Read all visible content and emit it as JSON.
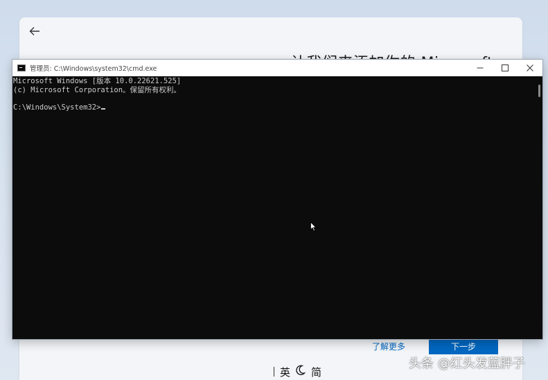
{
  "oobe": {
    "title": "让我们来添加你的 Microsoft",
    "learn_more": "了解更多",
    "next": "下一步"
  },
  "cmd": {
    "title": "管理员: C:\\Windows\\system32\\cmd.exe",
    "lines": [
      "Microsoft Windows [版本 10.0.22621.525]",
      "(c) Microsoft Corporation。保留所有权利。",
      "",
      "C:\\Windows\\System32>"
    ]
  },
  "ime": {
    "lang": "英",
    "mode_icon": "moon-icon",
    "script": "简"
  },
  "icons": {
    "back": "arrow-left-icon",
    "minimize": "minimize-icon",
    "maximize": "maximize-icon",
    "close": "close-icon"
  },
  "colors": {
    "accent": "#0067c0",
    "console_bg": "#0c0c0c",
    "console_fg": "#cccccc"
  },
  "watermark": "头条 @红头发蓝胖子"
}
